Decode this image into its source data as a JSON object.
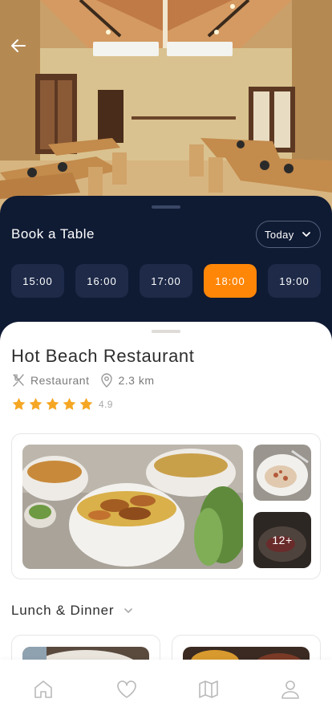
{
  "hero": {
    "back_icon": "arrow-left-icon"
  },
  "booking": {
    "title": "Book a Table",
    "date_value": "Today",
    "date_icon": "chevron-down-icon",
    "times": [
      {
        "label": "15:00",
        "selected": false
      },
      {
        "label": "16:00",
        "selected": false
      },
      {
        "label": "17:00",
        "selected": false
      },
      {
        "label": "18:00",
        "selected": true
      },
      {
        "label": "19:00",
        "selected": false
      }
    ]
  },
  "restaurant": {
    "name": "Hot Beach Restaurant",
    "category": "Restaurant",
    "category_icon": "fork-knife-icon",
    "distance": "2.3 km",
    "distance_icon": "location-pin-icon",
    "rating": 4.9,
    "rating_text": "4.9",
    "stars": 5
  },
  "gallery": {
    "more_count": "12+"
  },
  "menu": {
    "selected": "Lunch & Dinner",
    "icon": "chevron-down-icon"
  },
  "nav": {
    "items": [
      {
        "icon": "home-icon"
      },
      {
        "icon": "heart-icon"
      },
      {
        "icon": "map-icon"
      },
      {
        "icon": "user-icon"
      }
    ]
  },
  "colors": {
    "accent": "#ff8607",
    "dark_panel": "#0f1a33",
    "chip": "#1e2a48",
    "star": "#f5a623"
  }
}
